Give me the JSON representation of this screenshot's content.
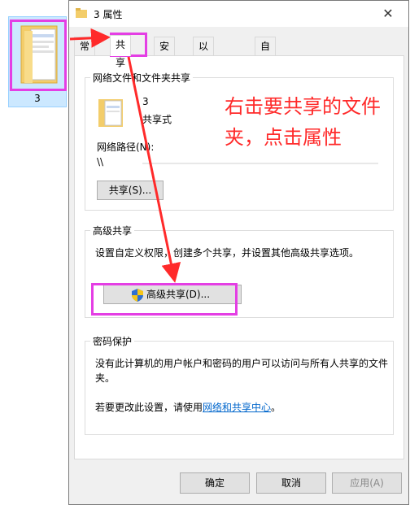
{
  "desktop": {
    "folder_label": "3"
  },
  "dialog": {
    "title": "3 属性",
    "close_glyph": "✕",
    "tabs": [
      {
        "label": "常规"
      },
      {
        "label": "共享"
      },
      {
        "label": "安全"
      },
      {
        "label": "以前的版本"
      },
      {
        "label": "自定义"
      }
    ],
    "network_group": {
      "title": "网络文件和文件夹共享",
      "item_name": "3",
      "item_status": "共享式",
      "path_label": "网络路径(N):",
      "path_value": "\\\\",
      "share_button": "共享(S)..."
    },
    "advanced_group": {
      "title": "高级共享",
      "description": "设置自定义权限，创建多个共享，并设置其他高级共享选项。",
      "button": "高级共享(D)..."
    },
    "password_group": {
      "title": "密码保护",
      "description": "没有此计算机的用户帐户和密码的用户可以访问与所有人共享的文件夹。",
      "change_prefix": "若要更改此设置，请使用",
      "link": "网络和共享中心",
      "change_suffix": "。"
    },
    "buttons": {
      "ok": "确定",
      "cancel": "取消",
      "apply": "应用(A)"
    }
  },
  "annotation": {
    "text": "右击要共享的文件夹，点击属性"
  },
  "colors": {
    "highlight": "#e43ee4",
    "arrow": "#ff2a2a",
    "link": "#0066cc"
  }
}
